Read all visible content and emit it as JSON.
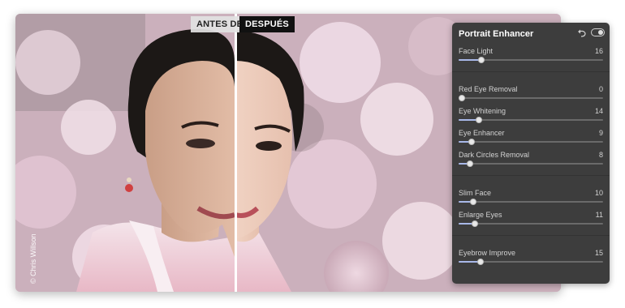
{
  "compare": {
    "before_label": "ANTES DE",
    "after_label": "DESPUÉS"
  },
  "watermark": "© Chris Willson",
  "panel": {
    "title": "Portrait Enhancer",
    "icons": {
      "reset": "undo-icon",
      "toggle": "toggle-switch"
    },
    "enabled": true,
    "accent_color": "#a8b8e8",
    "max_value": 100,
    "groups": [
      {
        "sliders": [
          {
            "label": "Face Light",
            "value": 16
          }
        ]
      },
      {
        "sliders": [
          {
            "label": "Red Eye Removal",
            "value": 0
          },
          {
            "label": "Eye Whitening",
            "value": 14
          },
          {
            "label": "Eye Enhancer",
            "value": 9
          },
          {
            "label": "Dark Circles Removal",
            "value": 8
          }
        ]
      },
      {
        "sliders": [
          {
            "label": "Slim Face",
            "value": 10
          },
          {
            "label": "Enlarge Eyes",
            "value": 11
          }
        ]
      },
      {
        "sliders": [
          {
            "label": "Eyebrow Improve",
            "value": 15
          }
        ]
      }
    ]
  }
}
